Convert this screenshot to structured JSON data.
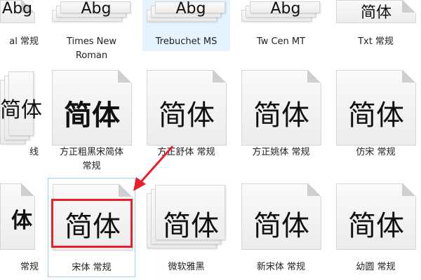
{
  "colors": {
    "selection": "#e5f3ff",
    "highlight": "#e8202a",
    "arrow": "#e8202a"
  },
  "rows": [
    {
      "items": [
        {
          "name": "al 常规",
          "sample": "Abg",
          "stack": false
        },
        {
          "name": "Times New Roman",
          "sample": "Abg",
          "stack": true
        },
        {
          "name": "Trebuchet MS",
          "sample": "Abg",
          "stack": true,
          "selected": true
        },
        {
          "name": "Tw Cen MT",
          "sample": "Abg",
          "stack": true
        },
        {
          "name": "Txt 常规",
          "sample": "简体",
          "stack": false
        }
      ]
    },
    {
      "items": [
        {
          "name": "线",
          "sample": "简体",
          "stack": true
        },
        {
          "name": "方正粗黑宋简体 常规",
          "sample": "简体",
          "stack": false,
          "bold": true
        },
        {
          "name": "方正舒体 常规",
          "sample": "简体",
          "stack": false
        },
        {
          "name": "方正姚体 常规",
          "sample": "简体",
          "stack": false
        },
        {
          "name": "仿宋 常规",
          "sample": "简体",
          "stack": false
        }
      ]
    },
    {
      "items": [
        {
          "name": "常规",
          "sample": "体",
          "stack": false,
          "bold": true
        },
        {
          "name": "宋体 常规",
          "sample": "简体",
          "stack": false,
          "outlined": true
        },
        {
          "name": "微软雅黑",
          "sample": "简体",
          "stack": true
        },
        {
          "name": "新宋体 常规",
          "sample": "简体",
          "stack": false
        },
        {
          "name": "幼圆 常规",
          "sample": "简体",
          "stack": false
        }
      ]
    }
  ]
}
